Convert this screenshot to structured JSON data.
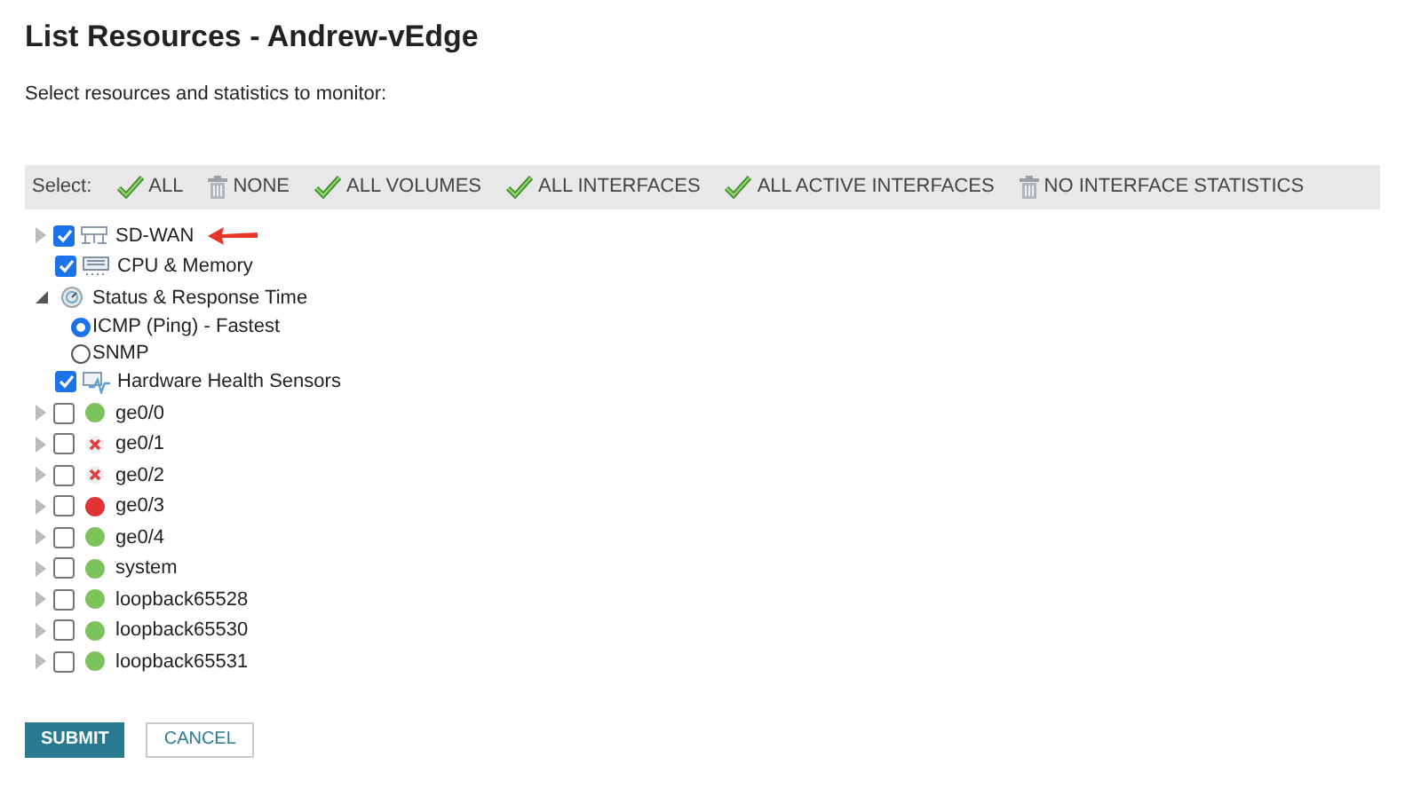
{
  "title": "List Resources - Andrew-vEdge",
  "subtitle": "Select resources and statistics to monitor:",
  "select_bar": {
    "label": "Select:",
    "actions": [
      {
        "label": "ALL",
        "kind": "check"
      },
      {
        "label": "NONE",
        "kind": "trash"
      },
      {
        "label": "ALL VOLUMES",
        "kind": "check"
      },
      {
        "label": "ALL INTERFACES",
        "kind": "check"
      },
      {
        "label": "ALL ACTIVE INTERFACES",
        "kind": "check"
      },
      {
        "label": "NO INTERFACE STATISTICS",
        "kind": "trash"
      }
    ]
  },
  "tree": [
    {
      "label": "SD-WAN",
      "kind": "network",
      "checked": true,
      "expanded": false
    },
    {
      "label": "CPU & Memory",
      "kind": "cpu",
      "checked": true
    },
    {
      "label": "Status & Response Time",
      "kind": "status",
      "expanded": true,
      "options": [
        {
          "label": "ICMP (Ping) - Fastest",
          "selected": true
        },
        {
          "label": "SNMP",
          "selected": false
        }
      ]
    },
    {
      "label": "Hardware Health Sensors",
      "kind": "hardware",
      "checked": true
    },
    {
      "label": "ge0/0",
      "kind": "interface",
      "color": "#7dc35c",
      "checked": false,
      "expanded": false
    },
    {
      "label": "ge0/1",
      "kind": "unknown-interface",
      "checked": false,
      "expanded": false
    },
    {
      "label": "ge0/2",
      "kind": "unknown-interface",
      "checked": false,
      "expanded": false
    },
    {
      "label": "ge0/3",
      "kind": "interface",
      "color": "#e03434",
      "checked": false,
      "expanded": false
    },
    {
      "label": "ge0/4",
      "kind": "interface",
      "color": "#7dc35c",
      "checked": false,
      "expanded": false
    },
    {
      "label": "system",
      "kind": "interface",
      "color": "#7dc35c",
      "checked": false,
      "expanded": false
    },
    {
      "label": "loopback65528",
      "kind": "interface",
      "color": "#7dc35c",
      "checked": false,
      "expanded": false
    },
    {
      "label": "loopback65530",
      "kind": "interface",
      "color": "#7dc35c",
      "checked": false,
      "expanded": false
    },
    {
      "label": "loopback65531",
      "kind": "interface",
      "color": "#7dc35c",
      "checked": false,
      "expanded": false
    }
  ],
  "buttons": [
    {
      "label": "SUBMIT",
      "kind": "primary"
    },
    {
      "label": "CANCEL",
      "kind": "secondary"
    }
  ]
}
